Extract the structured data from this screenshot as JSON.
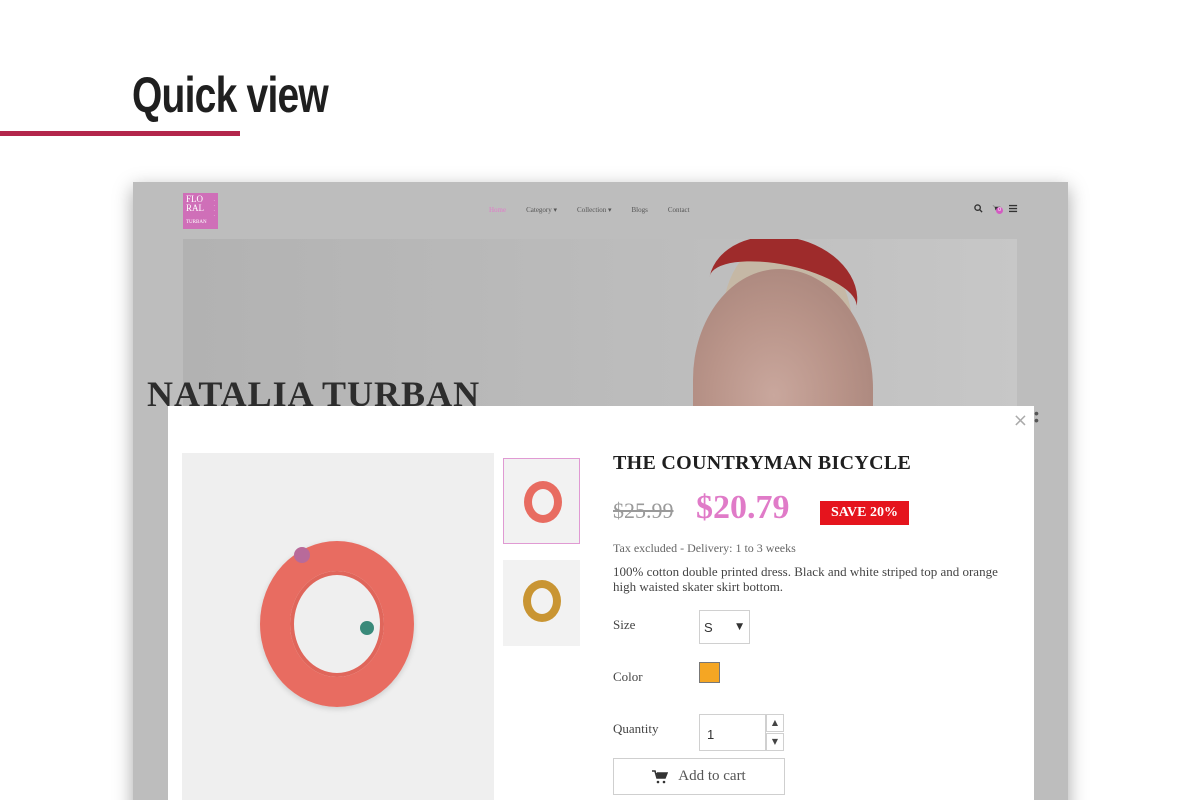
{
  "slide": {
    "title": "Quick view",
    "accent": "#b3264b"
  },
  "site": {
    "logo_text": "FLO RAL",
    "logo_sub": "TURBAN",
    "nav": [
      "Home",
      "Category ▾",
      "Collection ▾",
      "Blogs",
      "Contact"
    ],
    "active_nav": "Home",
    "cart_count": "0",
    "hero_headline": "NATALIA TURBAN"
  },
  "modal": {
    "product_name": "THE COUNTRYMAN BICYCLE",
    "old_price": "$25.99",
    "new_price": "$20.79",
    "save_badge": "SAVE 20%",
    "tax_note": "Tax excluded - Delivery: 1 to 3 weeks",
    "description": "100% cotton double printed dress. Black and white striped top and orange high waisted skater skirt bottom.",
    "size_label": "Size",
    "size_value": "S",
    "color_label": "Color",
    "color_value": "#f5a623",
    "quantity_label": "Quantity",
    "quantity_value": "1",
    "add_to_cart_label": "Add to cart",
    "close_glyph": "×",
    "colors": {
      "price": "#e07bc8",
      "badge": "#e5141d"
    }
  }
}
